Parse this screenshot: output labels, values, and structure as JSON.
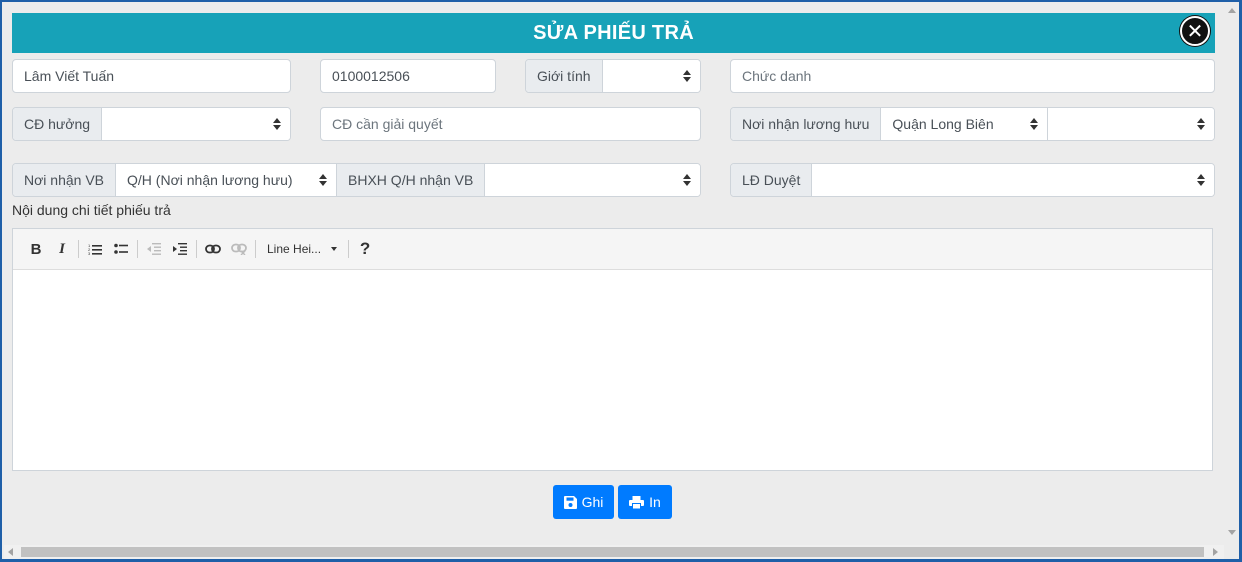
{
  "dialog": {
    "title": "SỬA PHIẾU TRẢ"
  },
  "form": {
    "name_value": "Lâm Viết Tuấn",
    "code_value": "0100012506",
    "gender_label": "Giới tính",
    "gender_value": "",
    "position_placeholder": "Chức danh",
    "benefit_label": "CĐ hưởng",
    "benefit_value": "",
    "resolve_placeholder": "CĐ cần giải quyết",
    "pension_label": "Nơi nhận lương hưu",
    "pension_district": "Quận Long Biên",
    "pension_ward": "",
    "doc_label": "Nơi nhận VB",
    "doc_value": "Q/H (Nơi nhận lương hưu)",
    "bhxh_label": "BHXH Q/H nhận VB",
    "bhxh_value": "",
    "approver_label": "LĐ Duyệt",
    "approver_value": ""
  },
  "editor": {
    "label": "Nội dung chi tiết phiếu trả",
    "bold": "B",
    "italic": "I",
    "line_height": "Line Hei...",
    "help": "?",
    "content": ""
  },
  "actions": {
    "save_label": "Ghi",
    "print_label": "In"
  },
  "colors": {
    "header": "#17a2b8",
    "primary": "#007bff",
    "addon": "#e9ecef"
  }
}
